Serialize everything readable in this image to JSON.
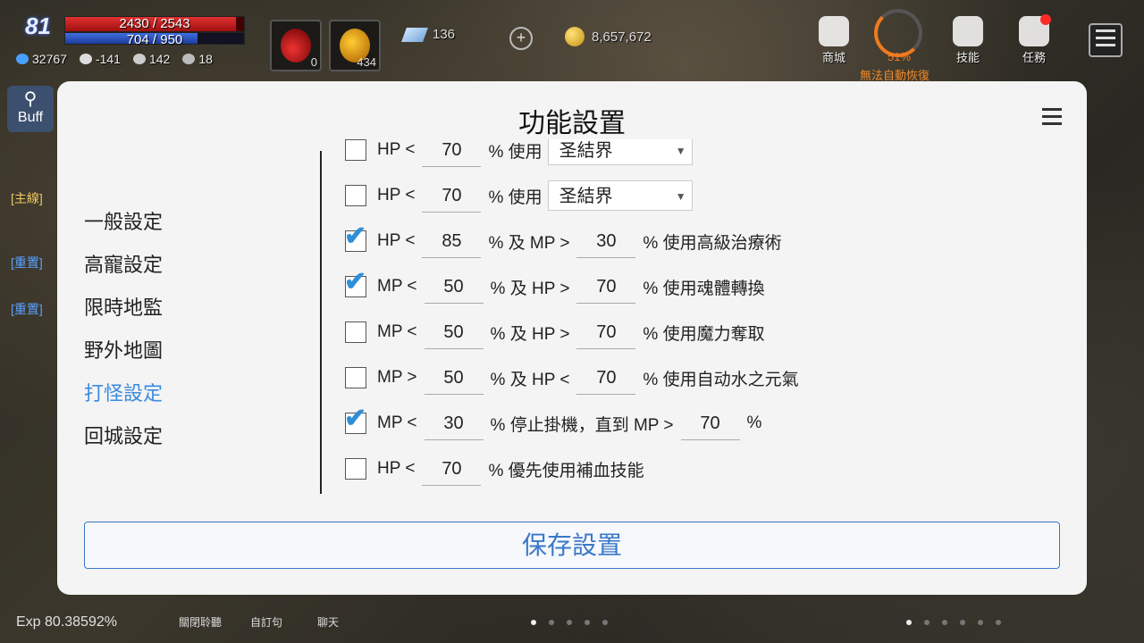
{
  "hud": {
    "level": "81",
    "hp_text": "2430 / 2543",
    "hp_fraction": 0.955,
    "mp_text": "704 / 950",
    "mp_fraction": 0.741,
    "stats": [
      "32767",
      "-141",
      "142",
      "18"
    ],
    "slots": [
      {
        "count": "0"
      },
      {
        "count": "434"
      }
    ],
    "gems": "136",
    "gold": "8,657,672",
    "buttons": [
      "商城",
      "技能",
      "任務"
    ],
    "progress_percent": "51%",
    "warning": "無法自動恢復",
    "buff_label": "Buff",
    "quest_tags": [
      "[主線]",
      "[重置]",
      "[重置]"
    ],
    "exp": "Exp  80.38592%",
    "bottom_buttons": [
      "關閉聆聽",
      "自訂句",
      "聊天"
    ]
  },
  "modal": {
    "title": "功能設置",
    "nav": [
      {
        "label": "一般設定",
        "active": false
      },
      {
        "label": "高寵設定",
        "active": false
      },
      {
        "label": "限時地監",
        "active": false
      },
      {
        "label": "野外地圖",
        "active": false
      },
      {
        "label": "打怪設定",
        "active": true
      },
      {
        "label": "回城設定",
        "active": false
      }
    ],
    "rows": [
      {
        "checked": false,
        "a": "HP <",
        "v1": "70",
        "b": "% 使用",
        "select": "圣結界"
      },
      {
        "checked": false,
        "a": "HP <",
        "v1": "70",
        "b": "% 使用",
        "select": "圣結界"
      },
      {
        "checked": true,
        "a": "HP <",
        "v1": "85",
        "b": "% 及 MP >",
        "v2": "30",
        "c": "% 使用高級治療術"
      },
      {
        "checked": true,
        "a": "MP <",
        "v1": "50",
        "b": "% 及 HP >",
        "v2": "70",
        "c": "% 使用魂體轉換"
      },
      {
        "checked": false,
        "a": "MP <",
        "v1": "50",
        "b": "% 及 HP >",
        "v2": "70",
        "c": "% 使用魔力奪取"
      },
      {
        "checked": false,
        "a": "MP >",
        "v1": "50",
        "b": "% 及 HP <",
        "v2": "70",
        "c": "% 使用自动水之元氣"
      },
      {
        "checked": true,
        "a": "MP <",
        "v1": "30",
        "b": "% 停止掛機，直到 MP >",
        "v2": "70",
        "c": "%"
      },
      {
        "checked": false,
        "a": "HP <",
        "v1": "70",
        "b": "% 優先使用補血技能"
      }
    ],
    "save_label": "保存設置"
  }
}
